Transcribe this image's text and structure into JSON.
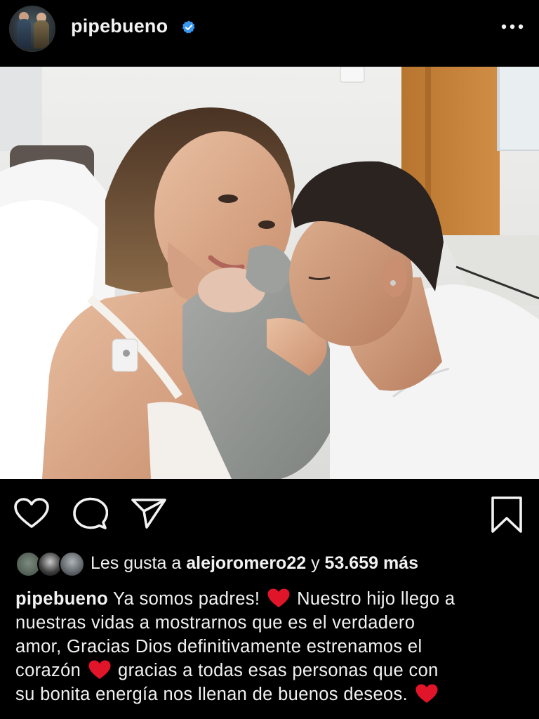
{
  "header": {
    "username": "pipebueno",
    "verified": true,
    "more_icon": "more-horizontal-icon"
  },
  "post": {
    "image_alt": "Family selfie in hospital room with newborn",
    "accent_color": "#3897f0"
  },
  "actions": {
    "like_icon": "heart-outline-icon",
    "comment_icon": "comment-bubble-icon",
    "share_icon": "paper-plane-icon",
    "save_icon": "bookmark-icon"
  },
  "likes": {
    "prefix": "Les gusta a ",
    "user": "alejoromero22",
    "connector": " y ",
    "count": "53.659 más"
  },
  "caption": {
    "author": "pipebueno",
    "line1_a": " Ya somos padres! ",
    "line1_b": " Nuestro hijo llego a",
    "line2": "nuestras vidas a mostrarnos que es el verdadero",
    "line3": "amor, Gracias Dios definitivamente estrenamos el",
    "line4_a": "corazón ",
    "line4_b": " gracias a todas esas personas que con",
    "line5_a": "su bonita energía nos llenan de buenos deseos. ",
    "heart_color": "#e0152a"
  }
}
